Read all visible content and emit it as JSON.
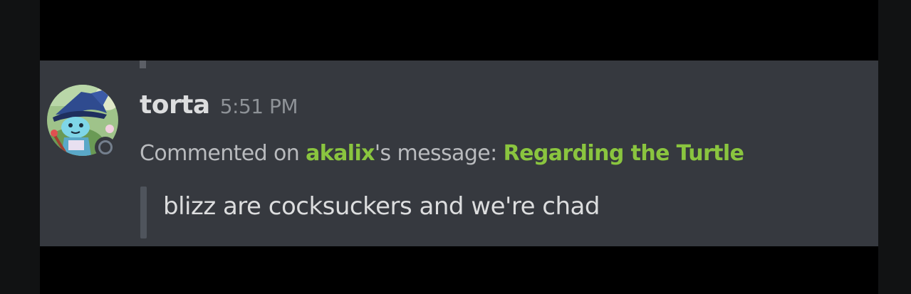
{
  "message": {
    "author": "torta",
    "timestamp": "5:51 PM",
    "avatar_icon": "wizard-character-avatar",
    "status": "offline",
    "comment": {
      "prefix": "Commented on ",
      "target_user": "akalix",
      "middle": "'s message: ",
      "target_title": "Regarding the Turtle"
    },
    "quote": "blizz are cocksuckers and we're chad"
  },
  "colors": {
    "background": "#36393f",
    "author": "#dcddde",
    "timestamp": "#8e9297",
    "muted_text": "#b9bbbe",
    "accent_green": "#8ac53f",
    "quote_bar": "#4f545c",
    "status_offline": "#747f8d"
  }
}
